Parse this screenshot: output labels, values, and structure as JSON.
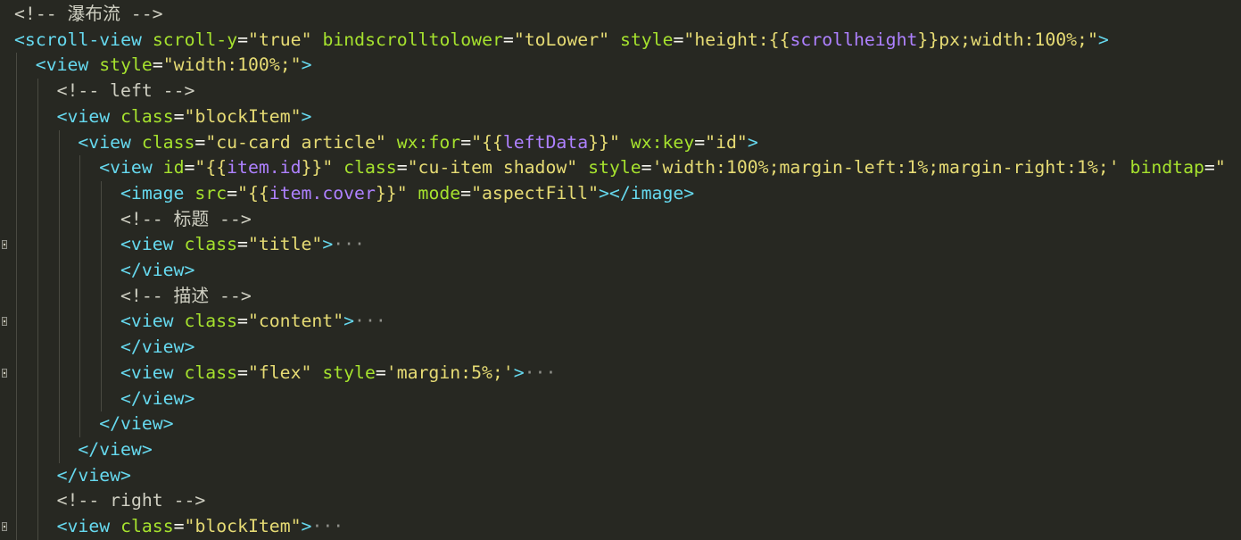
{
  "editor": {
    "lines": [
      {
        "indent": 0,
        "fold": false,
        "tokens": [
          {
            "cls": "t-comment",
            "text": "<!-- 瀑布流 -->"
          }
        ]
      },
      {
        "indent": 0,
        "fold": false,
        "tokens": [
          {
            "cls": "t-tag",
            "text": "<scroll-view"
          },
          {
            "cls": "t-plain",
            "text": " "
          },
          {
            "cls": "t-attr",
            "text": "scroll-y"
          },
          {
            "cls": "t-plain",
            "text": "="
          },
          {
            "cls": "t-str",
            "text": "\"true\""
          },
          {
            "cls": "t-plain",
            "text": " "
          },
          {
            "cls": "t-attr",
            "text": "bindscrolltolower"
          },
          {
            "cls": "t-plain",
            "text": "="
          },
          {
            "cls": "t-str",
            "text": "\"toLower\""
          },
          {
            "cls": "t-plain",
            "text": " "
          },
          {
            "cls": "t-attr",
            "text": "style"
          },
          {
            "cls": "t-plain",
            "text": "="
          },
          {
            "cls": "t-str",
            "text": "\"height:{{"
          },
          {
            "cls": "t-expr",
            "text": "scrollheight"
          },
          {
            "cls": "t-str",
            "text": "}}px;width:100%;\""
          },
          {
            "cls": "t-tag",
            "text": ">"
          }
        ]
      },
      {
        "indent": 1,
        "fold": false,
        "tokens": [
          {
            "cls": "t-tag",
            "text": "<view"
          },
          {
            "cls": "t-plain",
            "text": " "
          },
          {
            "cls": "t-attr",
            "text": "style"
          },
          {
            "cls": "t-plain",
            "text": "="
          },
          {
            "cls": "t-str",
            "text": "\"width:100%;\""
          },
          {
            "cls": "t-tag",
            "text": ">"
          }
        ]
      },
      {
        "indent": 2,
        "fold": false,
        "tokens": [
          {
            "cls": "t-comment",
            "text": "<!-- left -->"
          }
        ]
      },
      {
        "indent": 2,
        "fold": false,
        "tokens": [
          {
            "cls": "t-tag",
            "text": "<view"
          },
          {
            "cls": "t-plain",
            "text": " "
          },
          {
            "cls": "t-attr",
            "text": "class"
          },
          {
            "cls": "t-plain",
            "text": "="
          },
          {
            "cls": "t-str",
            "text": "\"blockItem\""
          },
          {
            "cls": "t-tag",
            "text": ">"
          }
        ]
      },
      {
        "indent": 3,
        "fold": false,
        "tokens": [
          {
            "cls": "t-tag",
            "text": "<view"
          },
          {
            "cls": "t-plain",
            "text": " "
          },
          {
            "cls": "t-attr",
            "text": "class"
          },
          {
            "cls": "t-plain",
            "text": "="
          },
          {
            "cls": "t-str",
            "text": "\"cu-card article\""
          },
          {
            "cls": "t-plain",
            "text": " "
          },
          {
            "cls": "t-attr",
            "text": "wx:for"
          },
          {
            "cls": "t-plain",
            "text": "="
          },
          {
            "cls": "t-str",
            "text": "\"{{"
          },
          {
            "cls": "t-expr",
            "text": "leftData"
          },
          {
            "cls": "t-str",
            "text": "}}\""
          },
          {
            "cls": "t-plain",
            "text": " "
          },
          {
            "cls": "t-attr",
            "text": "wx:key"
          },
          {
            "cls": "t-plain",
            "text": "="
          },
          {
            "cls": "t-str",
            "text": "\"id\""
          },
          {
            "cls": "t-tag",
            "text": ">"
          }
        ]
      },
      {
        "indent": 4,
        "fold": false,
        "tokens": [
          {
            "cls": "t-tag",
            "text": "<view"
          },
          {
            "cls": "t-plain",
            "text": " "
          },
          {
            "cls": "t-attr",
            "text": "id"
          },
          {
            "cls": "t-plain",
            "text": "="
          },
          {
            "cls": "t-str",
            "text": "\"{{"
          },
          {
            "cls": "t-expr",
            "text": "item.id"
          },
          {
            "cls": "t-str",
            "text": "}}\""
          },
          {
            "cls": "t-plain",
            "text": " "
          },
          {
            "cls": "t-attr",
            "text": "class"
          },
          {
            "cls": "t-plain",
            "text": "="
          },
          {
            "cls": "t-str",
            "text": "\"cu-item shadow\""
          },
          {
            "cls": "t-plain",
            "text": " "
          },
          {
            "cls": "t-attr",
            "text": "style"
          },
          {
            "cls": "t-plain",
            "text": "="
          },
          {
            "cls": "t-str",
            "text": "'width:100%;margin-left:1%;margin-right:1%;'"
          },
          {
            "cls": "t-plain",
            "text": " "
          },
          {
            "cls": "t-attr",
            "text": "bindtap"
          },
          {
            "cls": "t-plain",
            "text": "="
          },
          {
            "cls": "t-str",
            "text": "\""
          }
        ]
      },
      {
        "indent": 5,
        "fold": false,
        "tokens": [
          {
            "cls": "t-tag",
            "text": "<image"
          },
          {
            "cls": "t-plain",
            "text": " "
          },
          {
            "cls": "t-attr",
            "text": "src"
          },
          {
            "cls": "t-plain",
            "text": "="
          },
          {
            "cls": "t-str",
            "text": "\"{{"
          },
          {
            "cls": "t-expr",
            "text": "item.cover"
          },
          {
            "cls": "t-str",
            "text": "}}\""
          },
          {
            "cls": "t-plain",
            "text": " "
          },
          {
            "cls": "t-attr",
            "text": "mode"
          },
          {
            "cls": "t-plain",
            "text": "="
          },
          {
            "cls": "t-str",
            "text": "\"aspectFill\""
          },
          {
            "cls": "t-tag",
            "text": "></image>"
          }
        ]
      },
      {
        "indent": 5,
        "fold": false,
        "tokens": [
          {
            "cls": "t-comment",
            "text": "<!-- 标题 -->"
          }
        ]
      },
      {
        "indent": 5,
        "fold": true,
        "tokens": [
          {
            "cls": "t-tag",
            "text": "<view"
          },
          {
            "cls": "t-plain",
            "text": " "
          },
          {
            "cls": "t-attr",
            "text": "class"
          },
          {
            "cls": "t-plain",
            "text": "="
          },
          {
            "cls": "t-str",
            "text": "\"title\""
          },
          {
            "cls": "t-tag",
            "text": ">"
          },
          {
            "cls": "t-ellipsis",
            "text": "···"
          }
        ]
      },
      {
        "indent": 5,
        "fold": false,
        "tokens": [
          {
            "cls": "t-tag",
            "text": "</view>"
          }
        ]
      },
      {
        "indent": 5,
        "fold": false,
        "tokens": [
          {
            "cls": "t-comment",
            "text": "<!-- 描述 -->"
          }
        ]
      },
      {
        "indent": 5,
        "fold": true,
        "tokens": [
          {
            "cls": "t-tag",
            "text": "<view"
          },
          {
            "cls": "t-plain",
            "text": " "
          },
          {
            "cls": "t-attr",
            "text": "class"
          },
          {
            "cls": "t-plain",
            "text": "="
          },
          {
            "cls": "t-str",
            "text": "\"content\""
          },
          {
            "cls": "t-tag",
            "text": ">"
          },
          {
            "cls": "t-ellipsis",
            "text": "···"
          }
        ]
      },
      {
        "indent": 5,
        "fold": false,
        "tokens": [
          {
            "cls": "t-tag",
            "text": "</view>"
          }
        ]
      },
      {
        "indent": 5,
        "fold": true,
        "tokens": [
          {
            "cls": "t-tag",
            "text": "<view"
          },
          {
            "cls": "t-plain",
            "text": " "
          },
          {
            "cls": "t-attr",
            "text": "class"
          },
          {
            "cls": "t-plain",
            "text": "="
          },
          {
            "cls": "t-str",
            "text": "\"flex\""
          },
          {
            "cls": "t-plain",
            "text": " "
          },
          {
            "cls": "t-attr",
            "text": "style"
          },
          {
            "cls": "t-plain",
            "text": "="
          },
          {
            "cls": "t-str",
            "text": "'margin:5%;'"
          },
          {
            "cls": "t-tag",
            "text": ">"
          },
          {
            "cls": "t-ellipsis",
            "text": "···"
          }
        ]
      },
      {
        "indent": 5,
        "fold": false,
        "tokens": [
          {
            "cls": "t-tag",
            "text": "</view>"
          }
        ]
      },
      {
        "indent": 4,
        "fold": false,
        "tokens": [
          {
            "cls": "t-tag",
            "text": "</view>"
          }
        ]
      },
      {
        "indent": 3,
        "fold": false,
        "tokens": [
          {
            "cls": "t-tag",
            "text": "</view>"
          }
        ]
      },
      {
        "indent": 2,
        "fold": false,
        "tokens": [
          {
            "cls": "t-tag",
            "text": "</view>"
          }
        ]
      },
      {
        "indent": 2,
        "fold": false,
        "tokens": [
          {
            "cls": "t-comment",
            "text": "<!-- right -->"
          }
        ]
      },
      {
        "indent": 2,
        "fold": true,
        "tokens": [
          {
            "cls": "t-tag",
            "text": "<view"
          },
          {
            "cls": "t-plain",
            "text": " "
          },
          {
            "cls": "t-attr",
            "text": "class"
          },
          {
            "cls": "t-plain",
            "text": "="
          },
          {
            "cls": "t-str",
            "text": "\"blockItem\""
          },
          {
            "cls": "t-tag",
            "text": ">"
          },
          {
            "cls": "t-ellipsis",
            "text": "···"
          }
        ]
      }
    ]
  }
}
